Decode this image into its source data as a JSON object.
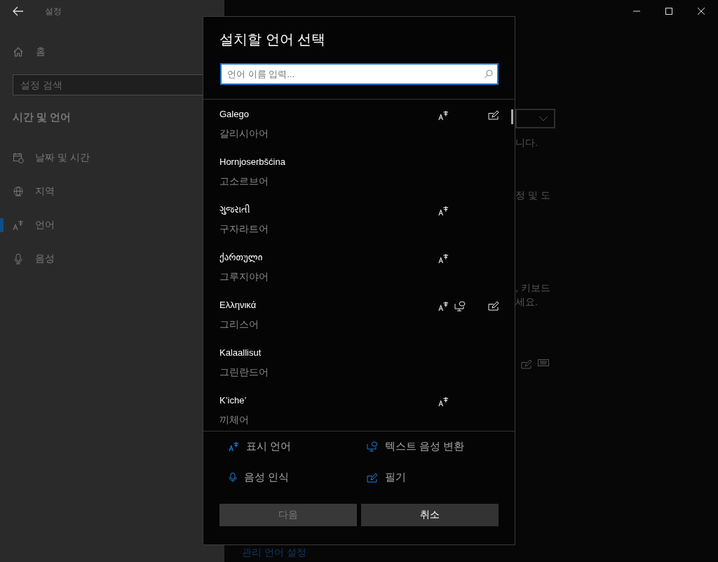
{
  "window": {
    "title": "설정"
  },
  "sidebar": {
    "home": "홈",
    "search": {
      "placeholder": "설정 검색"
    },
    "section": "시간 및 언어",
    "items": [
      {
        "label": "날짜 및 시간",
        "kind": "calendar",
        "selected": false
      },
      {
        "label": "지역",
        "kind": "globe",
        "selected": false
      },
      {
        "label": "언어",
        "kind": "language",
        "selected": true
      },
      {
        "label": "음성",
        "kind": "mic",
        "selected": false
      }
    ]
  },
  "background": {
    "fragments": [
      "니다.",
      "정 및 도",
      ", 키보드",
      "세요."
    ],
    "link": "관리 언어 설정"
  },
  "dialog": {
    "title": "설치할 언어 선택",
    "search": {
      "placeholder": "언어 이름 입력..."
    },
    "languages": [
      {
        "name": "Galego",
        "korean": "갈리시아어",
        "display": true,
        "tts": false,
        "speech": false,
        "handwriting": true
      },
      {
        "name": "Hornjoserbšćina",
        "korean": "고소르브어",
        "display": false,
        "tts": false,
        "speech": false,
        "handwriting": false
      },
      {
        "name": "ગુજરાતી",
        "korean": "구자라트어",
        "display": true,
        "tts": false,
        "speech": false,
        "handwriting": false
      },
      {
        "name": "ქართული",
        "korean": "그루지야어",
        "display": true,
        "tts": false,
        "speech": false,
        "handwriting": false
      },
      {
        "name": "Ελληνικά",
        "korean": "그리스어",
        "display": true,
        "tts": true,
        "speech": false,
        "handwriting": true
      },
      {
        "name": "Kalaallisut",
        "korean": "그린란드어",
        "display": false,
        "tts": false,
        "speech": false,
        "handwriting": false
      },
      {
        "name": "K’iche’",
        "korean": "끼체어",
        "display": true,
        "tts": false,
        "speech": false,
        "handwriting": false
      }
    ],
    "legend": [
      {
        "kind": "display",
        "label": "표시 언어"
      },
      {
        "kind": "tts",
        "label": "텍스트 음성 변환"
      },
      {
        "kind": "speech",
        "label": "음성 인식"
      },
      {
        "kind": "handwriting",
        "label": "필기"
      }
    ],
    "buttons": [
      {
        "label": "다음",
        "disabled": true
      },
      {
        "label": "취소",
        "disabled": false
      }
    ]
  }
}
